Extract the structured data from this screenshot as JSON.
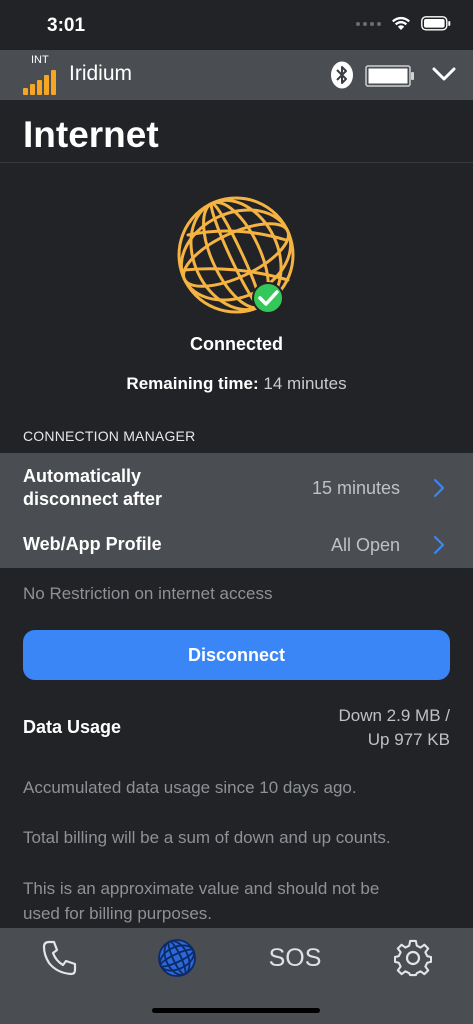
{
  "status_bar": {
    "time": "3:01",
    "icons": [
      "cellular-dots-icon",
      "wifi-icon",
      "battery-icon"
    ]
  },
  "device_bar": {
    "network_label": "INT",
    "device_name": "Iridium",
    "icons": [
      "signal-bars-icon",
      "bluetooth-icon",
      "device-battery-icon",
      "chevron-down-icon"
    ],
    "signal_bars": 5,
    "accent_color": "#f5a623"
  },
  "page": {
    "title": "Internet"
  },
  "connection": {
    "status": "Connected",
    "remaining_label": "Remaining time:",
    "remaining_value": "14 minutes",
    "status_color": "#34c759"
  },
  "connection_manager": {
    "header": "CONNECTION MANAGER",
    "auto_disconnect_line1": "Automatically",
    "auto_disconnect_line2": "disconnect after",
    "auto_disconnect_value": "15 minutes",
    "profile_label": "Web/App Profile",
    "profile_value": "All Open",
    "profile_note": "No Restriction on internet access"
  },
  "disconnect_button": {
    "label": "Disconnect",
    "color": "#3a86f7"
  },
  "data_usage": {
    "label": "Data Usage",
    "down": "Down 2.9 MB /",
    "up": "Up 977 KB",
    "notes": [
      "Accumulated data usage since 10 days ago.",
      "Total billing will be a sum of down and up counts.",
      "This is an approximate value and should not be",
      "used for billing purposes."
    ]
  },
  "tab_bar": {
    "tabs": [
      {
        "icon": "phone-icon"
      },
      {
        "icon": "globe-icon",
        "active": true
      },
      {
        "label": "SOS"
      },
      {
        "icon": "gear-icon"
      }
    ]
  }
}
